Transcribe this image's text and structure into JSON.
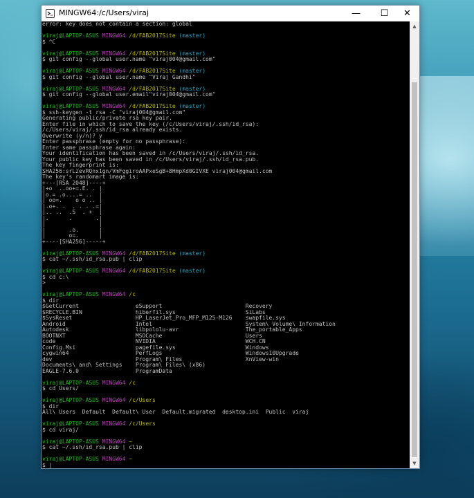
{
  "window": {
    "title": "MINGW64:/c/Users/viraj",
    "controls": {
      "minimize": "—",
      "maximize": "☐",
      "close": "✕"
    }
  },
  "colors": {
    "user": "#25bc24",
    "host": "#bc3fbc",
    "path": "#bcbc00",
    "branch": "#1fa9c9",
    "text": "#c0c0c0"
  },
  "terminal": {
    "lines": [
      [
        {
          "t": "error: key does not contain a section: global",
          "c": "text"
        }
      ],
      [
        {
          "t": "",
          "c": "text"
        }
      ],
      [
        {
          "t": "viraj@LAPTOP-ASUS",
          "c": "user"
        },
        {
          "t": " ",
          "c": "text"
        },
        {
          "t": "MINGW64",
          "c": "host"
        },
        {
          "t": " /d/FAB2017Site",
          "c": "path"
        },
        {
          "t": " (master)",
          "c": "branch"
        }
      ],
      [
        {
          "t": "$ ^C",
          "c": "text"
        }
      ],
      [
        {
          "t": "",
          "c": "text"
        }
      ],
      [
        {
          "t": "viraj@LAPTOP-ASUS",
          "c": "user"
        },
        {
          "t": " ",
          "c": "text"
        },
        {
          "t": "MINGW64",
          "c": "host"
        },
        {
          "t": " /d/FAB2017Site",
          "c": "path"
        },
        {
          "t": " (master)",
          "c": "branch"
        }
      ],
      [
        {
          "t": "$ git config --global user.name \"viraj004@gmail.com\"",
          "c": "text"
        }
      ],
      [
        {
          "t": "",
          "c": "text"
        }
      ],
      [
        {
          "t": "viraj@LAPTOP-ASUS",
          "c": "user"
        },
        {
          "t": " ",
          "c": "text"
        },
        {
          "t": "MINGW64",
          "c": "host"
        },
        {
          "t": " /d/FAB2017Site",
          "c": "path"
        },
        {
          "t": " (master)",
          "c": "branch"
        }
      ],
      [
        {
          "t": "$ git config --global user.name \"Viraj Gandhi\"",
          "c": "text"
        }
      ],
      [
        {
          "t": "",
          "c": "text"
        }
      ],
      [
        {
          "t": "viraj@LAPTOP-ASUS",
          "c": "user"
        },
        {
          "t": " ",
          "c": "text"
        },
        {
          "t": "MINGW64",
          "c": "host"
        },
        {
          "t": " /d/FAB2017Site",
          "c": "path"
        },
        {
          "t": " (master)",
          "c": "branch"
        }
      ],
      [
        {
          "t": "$ git config --global user.email\"viraj004@gmail.com\"",
          "c": "text"
        }
      ],
      [
        {
          "t": "",
          "c": "text"
        }
      ],
      [
        {
          "t": "viraj@LAPTOP-ASUS",
          "c": "user"
        },
        {
          "t": " ",
          "c": "text"
        },
        {
          "t": "MINGW64",
          "c": "host"
        },
        {
          "t": " /d/FAB2017Site",
          "c": "path"
        },
        {
          "t": " (master)",
          "c": "branch"
        }
      ],
      [
        {
          "t": "$ ssh-keygen -t rsa -C \"viraj004@gmail.com\"",
          "c": "text"
        }
      ],
      [
        {
          "t": "Generating public/private rsa key pair.",
          "c": "text"
        }
      ],
      [
        {
          "t": "Enter file in which to save the key (/c/Users/viraj/.ssh/id_rsa):",
          "c": "text"
        }
      ],
      [
        {
          "t": "/c/Users/viraj/.ssh/id_rsa already exists.",
          "c": "text"
        }
      ],
      [
        {
          "t": "Overwrite (y/n)? y",
          "c": "text"
        }
      ],
      [
        {
          "t": "Enter passphrase (empty for no passphrase):",
          "c": "text"
        }
      ],
      [
        {
          "t": "Enter same passphrase again:",
          "c": "text"
        }
      ],
      [
        {
          "t": "Your identification has been saved in /c/Users/viraj/.ssh/id_rsa.",
          "c": "text"
        }
      ],
      [
        {
          "t": "Your public key has been saved in /c/Users/viraj/.ssh/id_rsa.pub.",
          "c": "text"
        }
      ],
      [
        {
          "t": "The key fingerprint is:",
          "c": "text"
        }
      ],
      [
        {
          "t": "SHA256:srLzevRQnx1gn/VmFggiroAAPxeSgB+8HmpXd0GIVXE viraj004@gmail.com",
          "c": "text"
        }
      ],
      [
        {
          "t": "The key's randomart image is:",
          "c": "text"
        }
      ],
      [
        {
          "t": "+---[RSA 2048]----+",
          "c": "text"
        }
      ],
      [
        {
          "t": "|+o  ..oo+=.E. . |",
          "c": "text"
        }
      ],
      [
        {
          "t": "|o.= .o....= ..  |",
          "c": "text"
        }
      ],
      [
        {
          "t": "| oo=.    o o .. |",
          "c": "text"
        }
      ],
      [
        {
          "t": "|.o+. .  . . . .=|",
          "c": "text"
        }
      ],
      [
        {
          "t": "|.. ..  .S  . +  |",
          "c": "text"
        }
      ],
      [
        {
          "t": "|.      .       .|",
          "c": "text"
        }
      ],
      [
        {
          "t": "|                |",
          "c": "text"
        }
      ],
      [
        {
          "t": "|       .o.      |",
          "c": "text"
        }
      ],
      [
        {
          "t": "|       o=.      |",
          "c": "text"
        }
      ],
      [
        {
          "t": "+----[SHA256]-----+",
          "c": "text"
        }
      ],
      [
        {
          "t": "",
          "c": "text"
        }
      ],
      [
        {
          "t": "viraj@LAPTOP-ASUS",
          "c": "user"
        },
        {
          "t": " ",
          "c": "text"
        },
        {
          "t": "MINGW64",
          "c": "host"
        },
        {
          "t": " /d/FAB2017Site",
          "c": "path"
        },
        {
          "t": " (master)",
          "c": "branch"
        }
      ],
      [
        {
          "t": "$ cat ~/.ssh/id_rsa.pub | clip",
          "c": "text"
        }
      ],
      [
        {
          "t": "",
          "c": "text"
        }
      ],
      [
        {
          "t": "viraj@LAPTOP-ASUS",
          "c": "user"
        },
        {
          "t": " ",
          "c": "text"
        },
        {
          "t": "MINGW64",
          "c": "host"
        },
        {
          "t": " /d/FAB2017Site",
          "c": "path"
        },
        {
          "t": " (master)",
          "c": "branch"
        }
      ],
      [
        {
          "t": "$ cd c:\\",
          "c": "text"
        }
      ],
      [
        {
          "t": ">",
          "c": "text"
        }
      ],
      [
        {
          "t": "",
          "c": "text"
        }
      ],
      [
        {
          "t": "viraj@LAPTOP-ASUS",
          "c": "user"
        },
        {
          "t": " ",
          "c": "text"
        },
        {
          "t": "MINGW64",
          "c": "host"
        },
        {
          "t": " /c",
          "c": "path"
        }
      ],
      [
        {
          "t": "$ dir",
          "c": "text"
        }
      ],
      [
        {
          "t": "$GetCurrent                 eSupport                         Recovery",
          "c": "text"
        }
      ],
      [
        {
          "t": "$RECYCLE.BIN                hiberfil.sys                     SiLabs",
          "c": "text"
        }
      ],
      [
        {
          "t": "$SysReset                   HP_LaserJet_Pro_MFP_M125-M126    swapfile.sys",
          "c": "text"
        }
      ],
      [
        {
          "t": "Android                     Intel                            System\\ Volume\\ Information",
          "c": "text"
        }
      ],
      [
        {
          "t": "Autodesk                    libpololu-avr                    The_portable_Apps",
          "c": "text"
        }
      ],
      [
        {
          "t": "BOOTNXT                     MSOCache                         Users",
          "c": "text"
        }
      ],
      [
        {
          "t": "code                        NVIDIA                           WCH.CN",
          "c": "text"
        }
      ],
      [
        {
          "t": "Config.Msi                  pagefile.sys                     Windows",
          "c": "text"
        }
      ],
      [
        {
          "t": "cygwin64                    PerfLogs                         Windows10Upgrade",
          "c": "text"
        }
      ],
      [
        {
          "t": "dev                         Program\\ Files                   XnView-win",
          "c": "text"
        }
      ],
      [
        {
          "t": "Documents\\ and\\ Settings    Program\\ Files\\ (x86)",
          "c": "text"
        }
      ],
      [
        {
          "t": "EAGLE-7.6.0                 ProgramData",
          "c": "text"
        }
      ],
      [
        {
          "t": "",
          "c": "text"
        }
      ],
      [
        {
          "t": "viraj@LAPTOP-ASUS",
          "c": "user"
        },
        {
          "t": " ",
          "c": "text"
        },
        {
          "t": "MINGW64",
          "c": "host"
        },
        {
          "t": " /c",
          "c": "path"
        }
      ],
      [
        {
          "t": "$ cd Users/",
          "c": "text"
        }
      ],
      [
        {
          "t": "",
          "c": "text"
        }
      ],
      [
        {
          "t": "viraj@LAPTOP-ASUS",
          "c": "user"
        },
        {
          "t": " ",
          "c": "text"
        },
        {
          "t": "MINGW64",
          "c": "host"
        },
        {
          "t": " /c/Users",
          "c": "path"
        }
      ],
      [
        {
          "t": "$ dir",
          "c": "text"
        }
      ],
      [
        {
          "t": "All\\ Users  Default  Default\\ User  Default.migrated  desktop.ini  Public  viraj",
          "c": "text"
        }
      ],
      [
        {
          "t": "",
          "c": "text"
        }
      ],
      [
        {
          "t": "viraj@LAPTOP-ASUS",
          "c": "user"
        },
        {
          "t": " ",
          "c": "text"
        },
        {
          "t": "MINGW64",
          "c": "host"
        },
        {
          "t": " /c/Users",
          "c": "path"
        }
      ],
      [
        {
          "t": "$ cd viraj/",
          "c": "text"
        }
      ],
      [
        {
          "t": "",
          "c": "text"
        }
      ],
      [
        {
          "t": "viraj@LAPTOP-ASUS",
          "c": "user"
        },
        {
          "t": " ",
          "c": "text"
        },
        {
          "t": "MINGW64",
          "c": "host"
        },
        {
          "t": " ~",
          "c": "path"
        }
      ],
      [
        {
          "t": "$ cat ~/.ssh/id_rsa.pub | clip",
          "c": "text"
        }
      ],
      [
        {
          "t": "",
          "c": "text"
        }
      ],
      [
        {
          "t": "viraj@LAPTOP-ASUS",
          "c": "user"
        },
        {
          "t": " ",
          "c": "text"
        },
        {
          "t": "MINGW64",
          "c": "host"
        },
        {
          "t": " ~",
          "c": "path"
        }
      ],
      [
        {
          "t": "$ ",
          "c": "text"
        },
        {
          "t": "|",
          "c": "cursor"
        }
      ]
    ]
  },
  "icons": {
    "app": "git-bash-icon",
    "scroll_up": "arrow-up-icon",
    "scroll_down": "arrow-down-icon"
  }
}
